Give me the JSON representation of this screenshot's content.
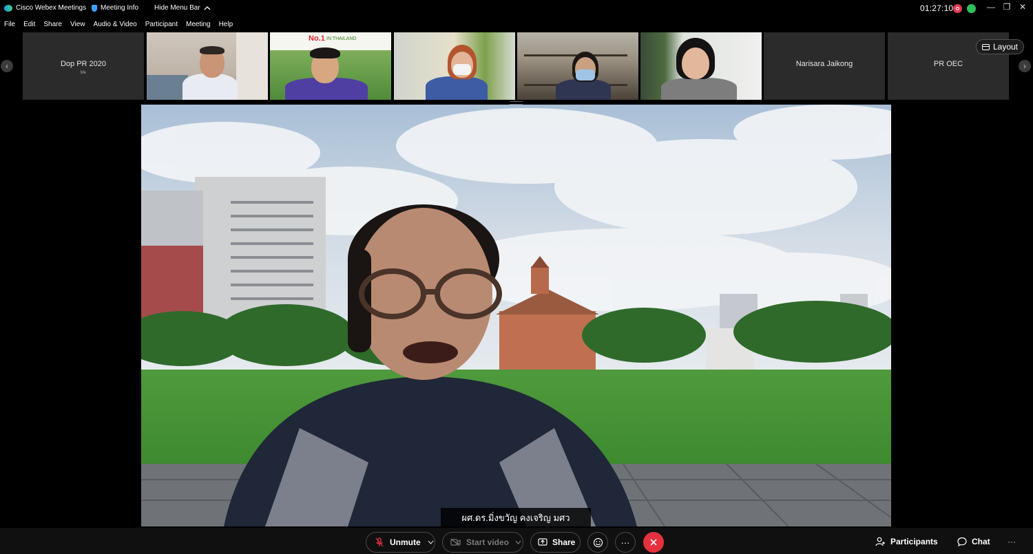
{
  "titlebar": {
    "app_title": "Cisco Webex Meetings",
    "meeting_info": "Meeting Info",
    "hide_menu_bar": "Hide Menu Bar",
    "clock": "01:27:10",
    "minimize": "—",
    "restore": "❐",
    "close": "✕"
  },
  "menu": [
    "File",
    "Edit",
    "Share",
    "View",
    "Audio & Video",
    "Participant",
    "Meeting",
    "Help"
  ],
  "thumbnails": {
    "prev_arrow": "‹",
    "next_arrow": "›",
    "self_name": "Dop PR 2020",
    "self_sub": "Me",
    "poster_headline": "No.1",
    "poster_sub": "IN THAILAND",
    "name_tile_1": "Narisara Jaikong",
    "name_tile_2": "PR OEC"
  },
  "layout_button": "Layout",
  "main_video": {
    "caption": "ผศ.ดร.มิ่งขวัญ คงเจริญ มศว"
  },
  "controls": {
    "unmute": "Unmute",
    "start_video": "Start video",
    "share": "Share",
    "more": "···",
    "participants": "Participants",
    "chat": "Chat",
    "overflow": "···"
  },
  "colors": {
    "end_call": "#e5313e",
    "recording": "#e23b52",
    "accent_webex": "#14a3dd"
  }
}
